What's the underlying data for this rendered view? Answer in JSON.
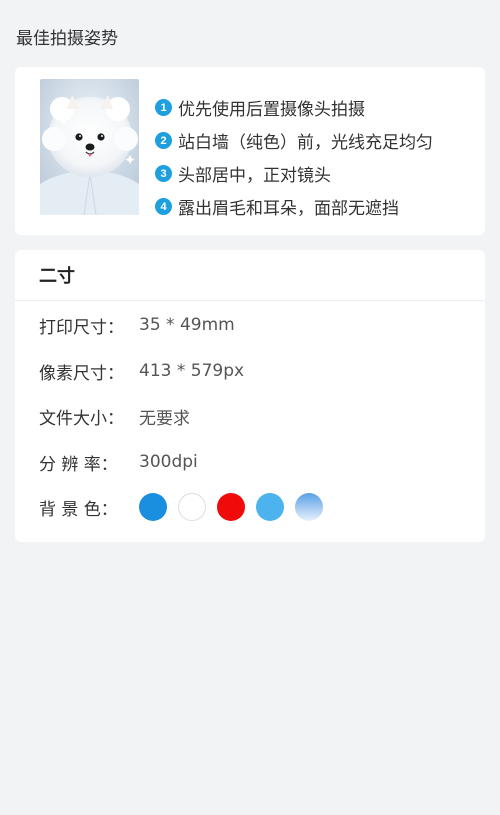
{
  "section_title": "最佳拍摄姿势",
  "tips": [
    {
      "num": "1",
      "text": "优先使用后置摄像头拍摄"
    },
    {
      "num": "2",
      "text": "站白墙（纯色）前，光线充足均匀"
    },
    {
      "num": "3",
      "text": "头部居中，正对镜头"
    },
    {
      "num": "4",
      "text": "露出眉毛和耳朵，面部无遮挡"
    }
  ],
  "spec": {
    "title": "二寸",
    "rows": [
      {
        "label": "打印尺寸：",
        "value": "35 * 49mm"
      },
      {
        "label": "像素尺寸：",
        "value": "413 * 579px"
      },
      {
        "label": "文件大小：",
        "value": "无要求"
      },
      {
        "label": "分 辨 率：",
        "value": "300dpi"
      }
    ],
    "background_label": "背 景 色：",
    "background_colors": [
      {
        "name": "blue",
        "color": "#1a8fe0"
      },
      {
        "name": "white",
        "color": "#ffffff"
      },
      {
        "name": "red",
        "color": "#f00a0a"
      },
      {
        "name": "light-blue",
        "color": "#4db3ef"
      },
      {
        "name": "gradient-blue",
        "color": "#5aa0e6"
      }
    ]
  }
}
